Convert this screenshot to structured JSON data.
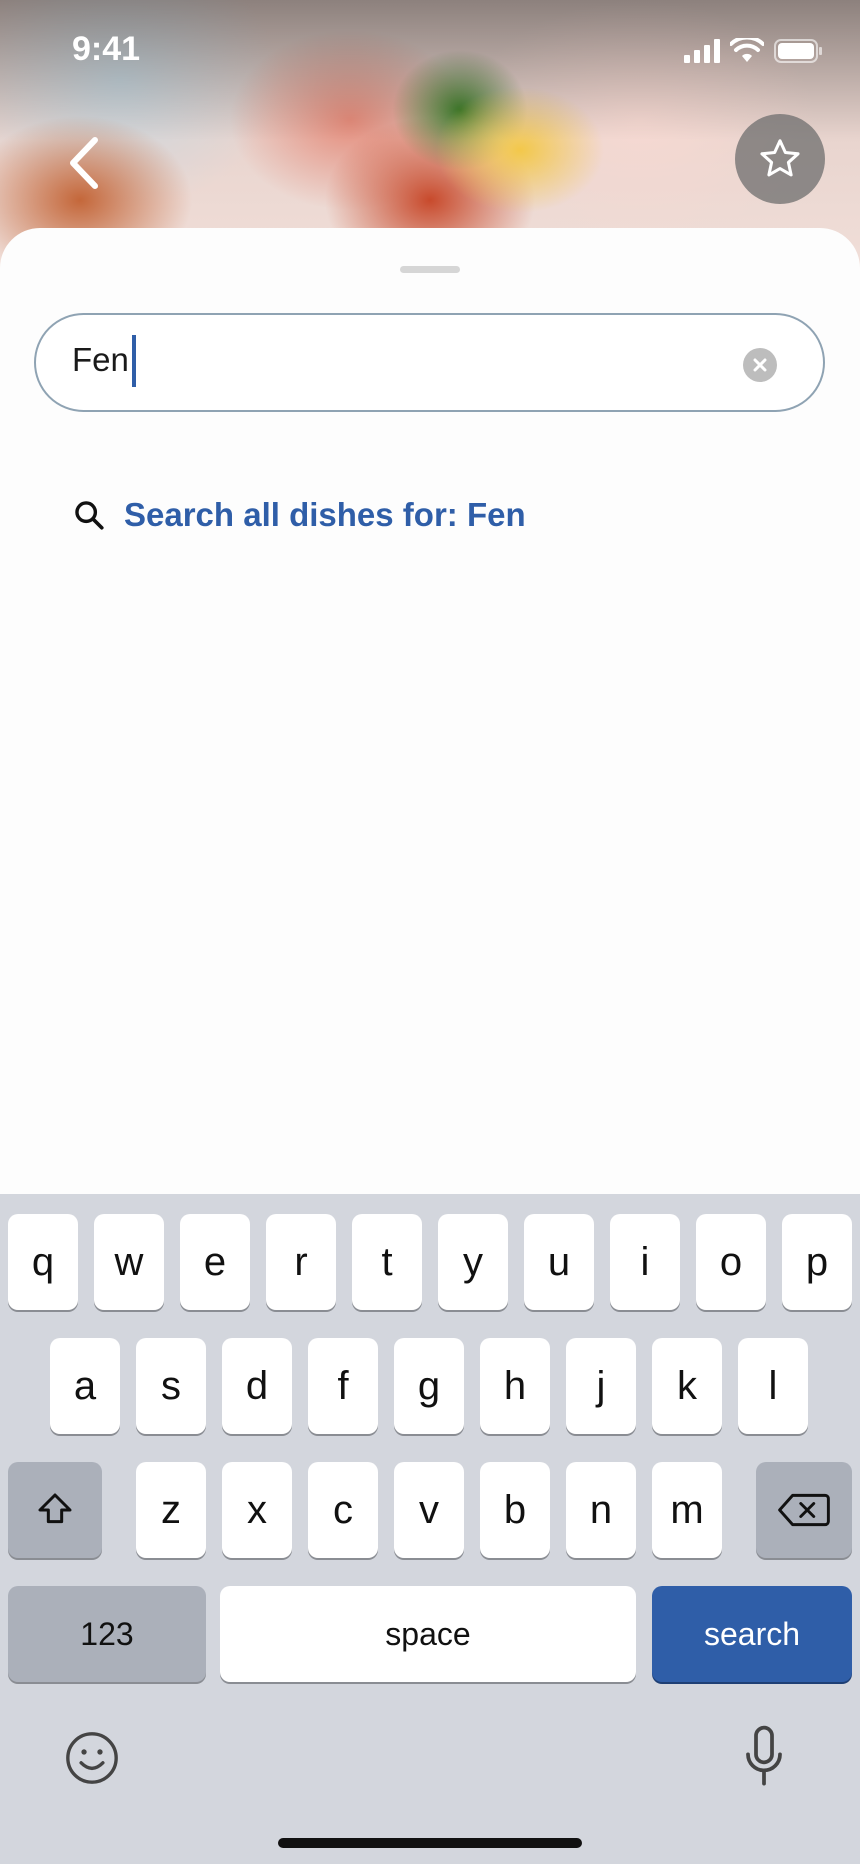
{
  "status_bar": {
    "time": "9:41"
  },
  "search": {
    "value": "Fen"
  },
  "suggestion": {
    "text": "Search all dishes for: Fen"
  },
  "keyboard": {
    "row1": [
      "q",
      "w",
      "e",
      "r",
      "t",
      "y",
      "u",
      "i",
      "o",
      "p"
    ],
    "row2": [
      "a",
      "s",
      "d",
      "f",
      "g",
      "h",
      "j",
      "k",
      "l"
    ],
    "row3": [
      "z",
      "x",
      "c",
      "v",
      "b",
      "n",
      "m"
    ],
    "numbers_label": "123",
    "space_label": "space",
    "search_label": "search"
  },
  "colors": {
    "accent": "#2f5ea8",
    "keyboard_bg": "#d3d6dd",
    "sheet_bg": "#fdfdfd"
  }
}
